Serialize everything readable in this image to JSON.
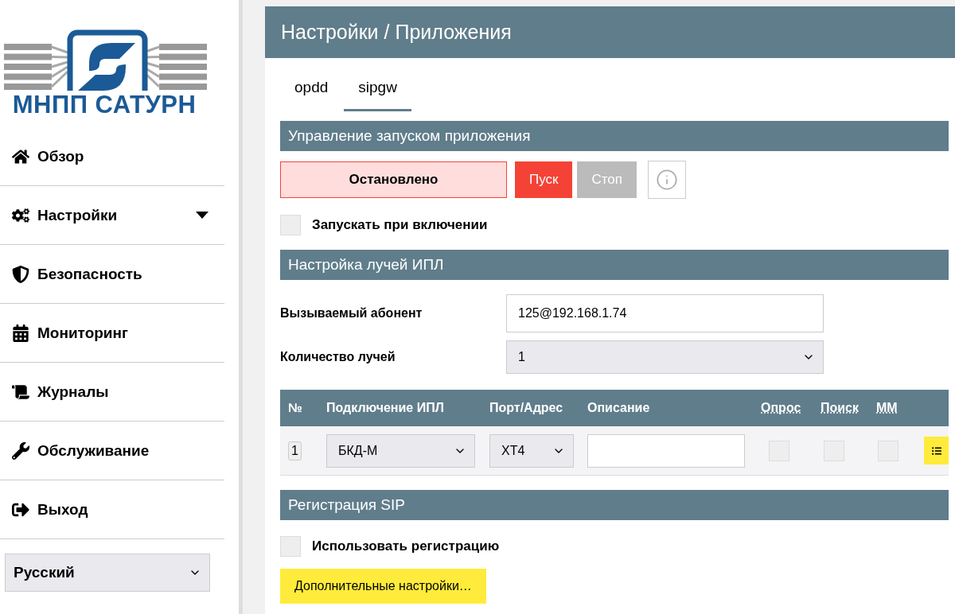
{
  "logo": {
    "text": "МНПП САТУРН"
  },
  "sidebar": {
    "items": [
      {
        "kind": "home",
        "label": "Обзор",
        "expandable": false
      },
      {
        "kind": "cogs",
        "label": "Настройки",
        "expandable": true
      },
      {
        "kind": "shield",
        "label": "Безопасность",
        "expandable": false
      },
      {
        "kind": "calendar",
        "label": "Мониторинг",
        "expandable": false
      },
      {
        "kind": "scroll",
        "label": "Журналы",
        "expandable": false
      },
      {
        "kind": "wrench",
        "label": "Обслуживание",
        "expandable": false
      },
      {
        "kind": "exit",
        "label": "Выход",
        "expandable": false
      }
    ],
    "language": "Русский"
  },
  "header": {
    "title": "Настройки / Приложения"
  },
  "tabs": [
    {
      "label": "opdd",
      "selected": false
    },
    {
      "label": "sipgw",
      "selected": true
    }
  ],
  "launch": {
    "title": "Управление запуском приложения",
    "status": "Остановлено",
    "running": false,
    "start": "Пуск",
    "stop": "Стоп",
    "autostart": {
      "label": "Запускать при включении",
      "checked": false
    }
  },
  "beams": {
    "title": "Настройка лучей ИПЛ",
    "fields": [
      {
        "kind": "input",
        "label": "Вызываемый абонент",
        "value": "125@192.168.1.74"
      },
      {
        "kind": "select",
        "label": "Количество лучей",
        "value": "1"
      }
    ],
    "table": {
      "columns": [
        {
          "label": "№",
          "underlined": false
        },
        {
          "label": "Подключение ИПЛ",
          "underlined": false
        },
        {
          "label": "Порт/Адрес",
          "underlined": false
        },
        {
          "label": "Описание",
          "underlined": false
        },
        {
          "label": "Опрос",
          "underlined": true
        },
        {
          "label": "Поиск",
          "underlined": true
        },
        {
          "label": "ММ",
          "underlined": true
        }
      ],
      "rows": [
        {
          "number": "1",
          "connection": "БКД-М",
          "port": "XT4",
          "poll": false,
          "search": false,
          "mm": false
        }
      ]
    }
  },
  "sip": {
    "title": "Регистрация SIP",
    "use": {
      "label": "Использовать регистрацию",
      "checked": false
    },
    "more": "Дополнительные настройки…"
  }
}
